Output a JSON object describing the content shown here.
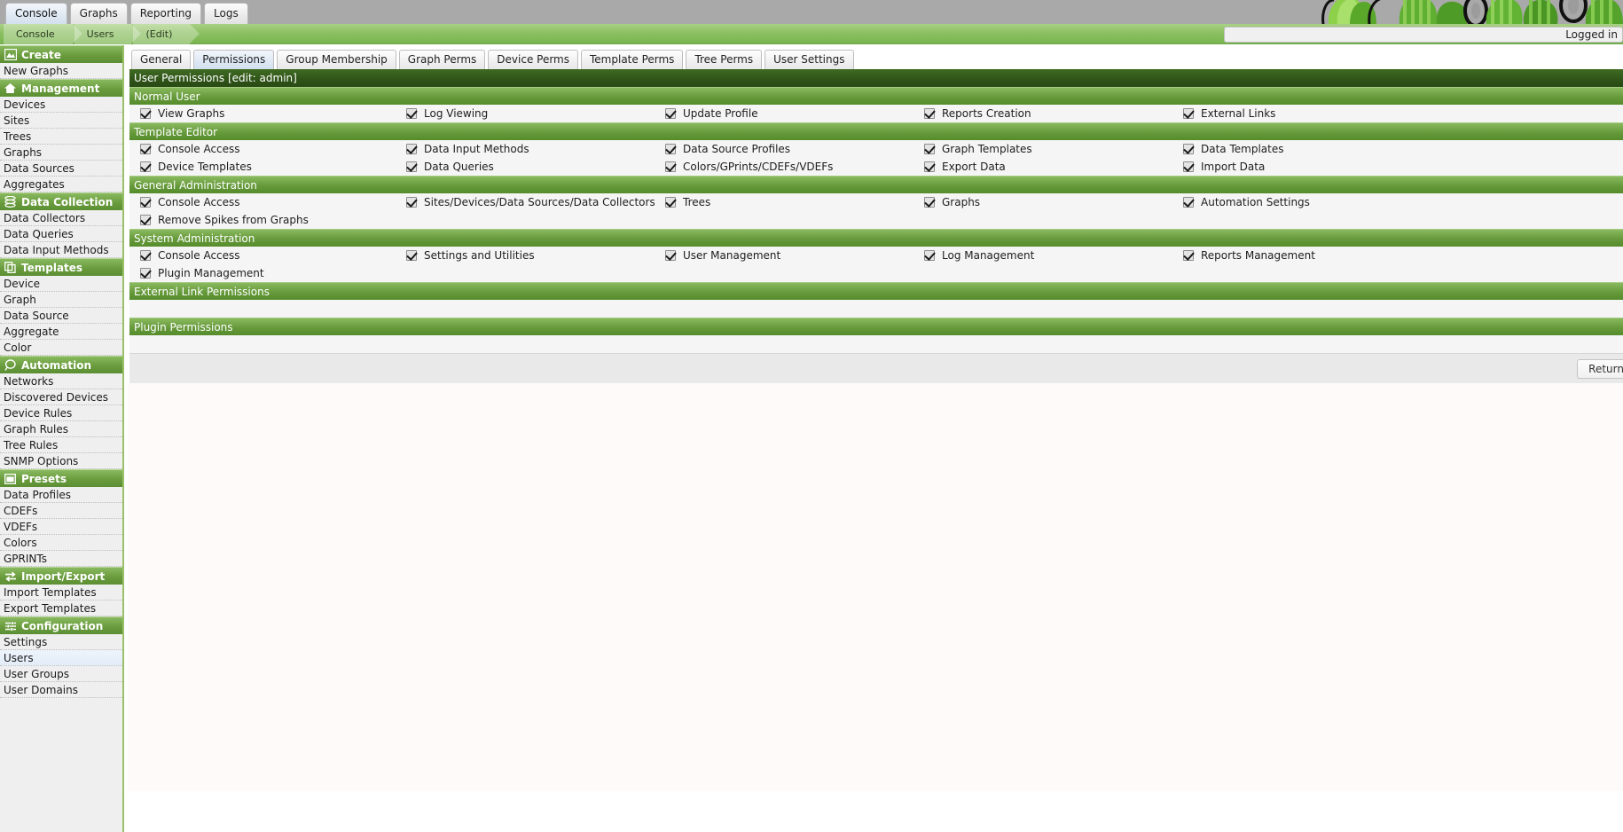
{
  "header": {
    "top_tabs": [
      {
        "label": "Console",
        "active": true
      },
      {
        "label": "Graphs",
        "active": false
      },
      {
        "label": "Reporting",
        "active": false
      },
      {
        "label": "Logs",
        "active": false
      }
    ],
    "breadcrumbs": [
      "Console",
      "Users",
      "(Edit)"
    ],
    "logged_in_text": "Logged in",
    "logo": "cacti-logo"
  },
  "sidebar": {
    "groups": [
      {
        "header": "Create",
        "icon": "graph-mountain-icon",
        "items": [
          {
            "label": "New Graphs",
            "selected": false
          }
        ]
      },
      {
        "header": "Management",
        "icon": "home-icon",
        "items": [
          {
            "label": "Devices",
            "selected": false
          },
          {
            "label": "Sites",
            "selected": false
          },
          {
            "label": "Trees",
            "selected": false
          },
          {
            "label": "Graphs",
            "selected": false
          },
          {
            "label": "Data Sources",
            "selected": false
          },
          {
            "label": "Aggregates",
            "selected": false
          }
        ]
      },
      {
        "header": "Data Collection",
        "icon": "database-icon",
        "items": [
          {
            "label": "Data Collectors",
            "selected": false
          },
          {
            "label": "Data Queries",
            "selected": false
          },
          {
            "label": "Data Input Methods",
            "selected": false
          }
        ]
      },
      {
        "header": "Templates",
        "icon": "copy-icon",
        "items": [
          {
            "label": "Device",
            "selected": false
          },
          {
            "label": "Graph",
            "selected": false
          },
          {
            "label": "Data Source",
            "selected": false
          },
          {
            "label": "Aggregate",
            "selected": false
          },
          {
            "label": "Color",
            "selected": false
          }
        ]
      },
      {
        "header": "Automation",
        "icon": "lasso-icon",
        "items": [
          {
            "label": "Networks",
            "selected": false
          },
          {
            "label": "Discovered Devices",
            "selected": false
          },
          {
            "label": "Device Rules",
            "selected": false
          },
          {
            "label": "Graph Rules",
            "selected": false
          },
          {
            "label": "Tree Rules",
            "selected": false
          },
          {
            "label": "SNMP Options",
            "selected": false
          }
        ]
      },
      {
        "header": "Presets",
        "icon": "window-icon",
        "items": [
          {
            "label": "Data Profiles",
            "selected": false
          },
          {
            "label": "CDEFs",
            "selected": false
          },
          {
            "label": "VDEFs",
            "selected": false
          },
          {
            "label": "Colors",
            "selected": false
          },
          {
            "label": "GPRINTs",
            "selected": false
          }
        ]
      },
      {
        "header": "Import/Export",
        "icon": "exchange-arrows-icon",
        "items": [
          {
            "label": "Import Templates",
            "selected": false
          },
          {
            "label": "Export Templates",
            "selected": false
          }
        ]
      },
      {
        "header": "Configuration",
        "icon": "sliders-icon",
        "items": [
          {
            "label": "Settings",
            "selected": false
          },
          {
            "label": "Users",
            "selected": true
          },
          {
            "label": "User Groups",
            "selected": false
          },
          {
            "label": "User Domains",
            "selected": false
          }
        ]
      }
    ]
  },
  "main": {
    "tabs": [
      {
        "label": "General",
        "active": false
      },
      {
        "label": "Permissions",
        "active": true
      },
      {
        "label": "Group Membership",
        "active": false
      },
      {
        "label": "Graph Perms",
        "active": false
      },
      {
        "label": "Device Perms",
        "active": false
      },
      {
        "label": "Template Perms",
        "active": false
      },
      {
        "label": "Tree Perms",
        "active": false
      },
      {
        "label": "User Settings",
        "active": false
      }
    ],
    "panel_title": "User Permissions [edit: admin]",
    "sections": [
      {
        "title": "Normal User",
        "rows": [
          [
            {
              "label": "View Graphs",
              "checked": true
            },
            {
              "label": "Log Viewing",
              "checked": true
            },
            {
              "label": "Update Profile",
              "checked": true
            },
            {
              "label": "Reports Creation",
              "checked": true
            },
            {
              "label": "External Links",
              "checked": true
            }
          ]
        ]
      },
      {
        "title": "Template Editor",
        "rows": [
          [
            {
              "label": "Console Access",
              "checked": true
            },
            {
              "label": "Data Input Methods",
              "checked": true
            },
            {
              "label": "Data Source Profiles",
              "checked": true
            },
            {
              "label": "Graph Templates",
              "checked": true
            },
            {
              "label": "Data Templates",
              "checked": true
            }
          ],
          [
            {
              "label": "Device Templates",
              "checked": true
            },
            {
              "label": "Data Queries",
              "checked": true
            },
            {
              "label": "Colors/GPrints/CDEFs/VDEFs",
              "checked": true
            },
            {
              "label": "Export Data",
              "checked": true
            },
            {
              "label": "Import Data",
              "checked": true
            }
          ]
        ]
      },
      {
        "title": "General Administration",
        "rows": [
          [
            {
              "label": "Console Access",
              "checked": true
            },
            {
              "label": "Sites/Devices/Data Sources/Data Collectors",
              "checked": true
            },
            {
              "label": "Trees",
              "checked": true
            },
            {
              "label": "Graphs",
              "checked": true
            },
            {
              "label": "Automation Settings",
              "checked": true
            }
          ],
          [
            {
              "label": "Remove Spikes from Graphs",
              "checked": true
            },
            {
              "label": "",
              "checked": null
            },
            {
              "label": "",
              "checked": null
            },
            {
              "label": "",
              "checked": null
            },
            {
              "label": "",
              "checked": null
            }
          ]
        ]
      },
      {
        "title": "System Administration",
        "rows": [
          [
            {
              "label": "Console Access",
              "checked": true
            },
            {
              "label": "Settings and Utilities",
              "checked": true
            },
            {
              "label": "User Management",
              "checked": true
            },
            {
              "label": "Log Management",
              "checked": true
            },
            {
              "label": "Reports Management",
              "checked": true
            }
          ],
          [
            {
              "label": "Plugin Management",
              "checked": true
            },
            {
              "label": "",
              "checked": null
            },
            {
              "label": "",
              "checked": null
            },
            {
              "label": "",
              "checked": null
            },
            {
              "label": "",
              "checked": null
            }
          ]
        ]
      },
      {
        "title": "External Link Permissions",
        "rows": []
      },
      {
        "title": "Plugin Permissions",
        "rows": []
      }
    ],
    "return_label": "Return"
  },
  "colors": {
    "accent_green": "#6a9c3e",
    "dark_green": "#2f5318",
    "breadcrumb_green": "#8cc063",
    "sidebar_bg": "#efefef",
    "panel_bg": "#f5f5f5",
    "topbar_gray": "#a9a9a9"
  }
}
